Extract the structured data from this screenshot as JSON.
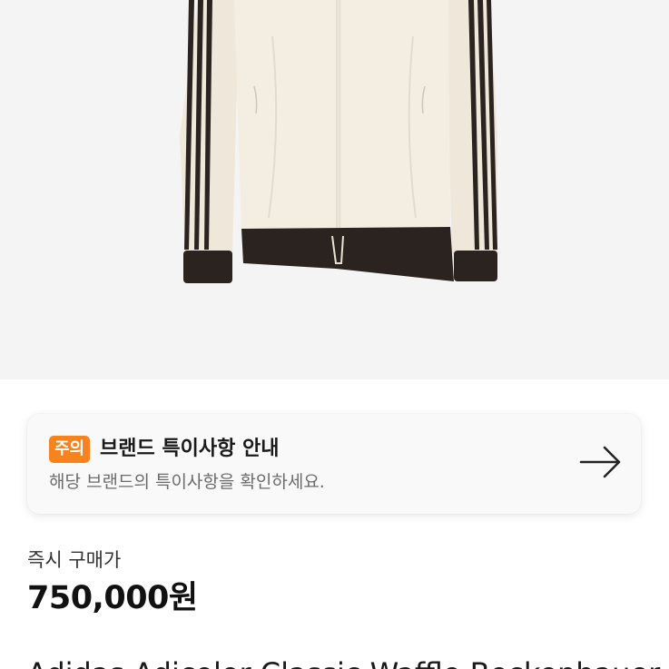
{
  "notice": {
    "badge": "주의",
    "title": "브랜드 특이사항 안내",
    "description": "해당 브랜드의 특이사항을 확인하세요."
  },
  "price": {
    "label": "즉시 구매가",
    "value": "750,000원"
  },
  "product": {
    "title": "Adidas Adicolor Classic Waffle Beckenbauer"
  },
  "colors": {
    "badge": "#f7831f",
    "image_background": "#f4f4f4",
    "jacket_body": "#f2ece0",
    "jacket_stripes": "#2a2320"
  }
}
